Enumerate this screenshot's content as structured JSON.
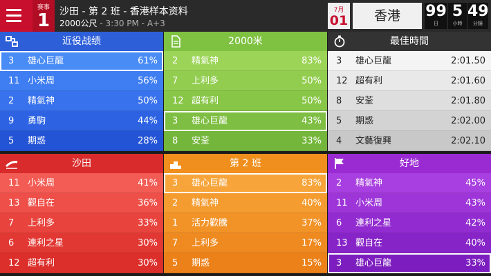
{
  "header": {
    "race_label": "赛事",
    "race_number": "1",
    "venue_line": "沙田 - 第 2 班 - 香港样本资料",
    "distance": "2000公尺",
    "time_handicap": "- 3:30 PM - A+3",
    "date_month": "7月",
    "date_day": "01",
    "place": "香港",
    "countdown": {
      "days": "99",
      "hours": "5",
      "minutes": "49",
      "days_unit": "日",
      "hours_unit": "小時",
      "minutes_unit": "分鐘"
    }
  },
  "colors": {
    "blue_head": "#2d5fd9",
    "green_head": "#7fc242",
    "gray_head": "#333333",
    "red_head": "#d92b2b",
    "orange_head": "#f08f1d",
    "purple_head": "#9a2bd3"
  },
  "panels": [
    {
      "title": "近役战绩",
      "icon": "form-icon",
      "rows": [
        {
          "no": "3",
          "horse": "雄心巨龍",
          "value": "61%",
          "bg": "#4a8cf6",
          "hl": true
        },
        {
          "no": "11",
          "horse": "小米周",
          "value": "56%",
          "bg": "#3e7ef2",
          "hl": false
        },
        {
          "no": "2",
          "horse": "精氣神",
          "value": "50%",
          "bg": "#3872ec",
          "hl": false
        },
        {
          "no": "9",
          "horse": "勇駒",
          "value": "44%",
          "bg": "#2d63e3",
          "hl": false
        },
        {
          "no": "5",
          "horse": "期惑",
          "value": "28%",
          "bg": "#2454d6",
          "hl": false
        }
      ]
    },
    {
      "title": "2000米",
      "icon": "distance-icon",
      "rows": [
        {
          "no": "2",
          "horse": "精氣神",
          "value": "83%",
          "bg": "#9cd457",
          "hl": false
        },
        {
          "no": "7",
          "horse": "上利多",
          "value": "50%",
          "bg": "#92cd50",
          "hl": false
        },
        {
          "no": "12",
          "horse": "超有利",
          "value": "50%",
          "bg": "#88c648",
          "hl": false
        },
        {
          "no": "3",
          "horse": "雄心巨龍",
          "value": "43%",
          "bg": "#7ebe42",
          "hl": true
        },
        {
          "no": "8",
          "horse": "安荃",
          "value": "33%",
          "bg": "#74b63b",
          "hl": false
        }
      ]
    },
    {
      "title": "最佳時間",
      "icon": "stopwatch-icon",
      "rows": [
        {
          "no": "3",
          "horse": "雄心巨龍",
          "value": "2:01.50",
          "bg": "#f4f4f4",
          "hl": false
        },
        {
          "no": "12",
          "horse": "超有利",
          "value": "2:01.60",
          "bg": "#e9e9e9",
          "hl": false
        },
        {
          "no": "8",
          "horse": "安荃",
          "value": "2:01.80",
          "bg": "#dedede",
          "hl": false
        },
        {
          "no": "5",
          "horse": "期惑",
          "value": "2:02.00",
          "bg": "#d3d3d3",
          "hl": false
        },
        {
          "no": "4",
          "horse": "文藝復興",
          "value": "2:02.10",
          "bg": "#c8c8c8",
          "hl": false
        }
      ]
    },
    {
      "title": "沙田",
      "icon": "track-icon",
      "rows": [
        {
          "no": "11",
          "horse": "小米周",
          "value": "41%",
          "bg": "#f25c54",
          "hl": false
        },
        {
          "no": "13",
          "horse": "觀自在",
          "value": "36%",
          "bg": "#ee4f48",
          "hl": false
        },
        {
          "no": "7",
          "horse": "上利多",
          "value": "33%",
          "bg": "#e8433d",
          "hl": false
        },
        {
          "no": "6",
          "horse": "連利之星",
          "value": "30%",
          "bg": "#e23833",
          "hl": false
        },
        {
          "no": "12",
          "horse": "超有利",
          "value": "30%",
          "bg": "#dc2e2a",
          "hl": false
        }
      ]
    },
    {
      "title": "第 2 班",
      "icon": "podium-icon",
      "rows": [
        {
          "no": "3",
          "horse": "雄心巨龍",
          "value": "83%",
          "bg": "#f7a53a",
          "hl": true
        },
        {
          "no": "2",
          "horse": "精氣神",
          "value": "40%",
          "bg": "#f59c30",
          "hl": false
        },
        {
          "no": "1",
          "horse": "活力歡騰",
          "value": "37%",
          "bg": "#f29328",
          "hl": false
        },
        {
          "no": "7",
          "horse": "上利多",
          "value": "17%",
          "bg": "#ef8a20",
          "hl": false
        },
        {
          "no": "5",
          "horse": "期惑",
          "value": "15%",
          "bg": "#ec8119",
          "hl": false
        }
      ]
    },
    {
      "title": "好地",
      "icon": "flag-icon",
      "rows": [
        {
          "no": "2",
          "horse": "精氣神",
          "value": "45%",
          "bg": "#a83fe0",
          "hl": false
        },
        {
          "no": "11",
          "horse": "小米周",
          "value": "43%",
          "bg": "#9d35d8",
          "hl": false
        },
        {
          "no": "6",
          "horse": "連利之星",
          "value": "42%",
          "bg": "#922cd0",
          "hl": false
        },
        {
          "no": "13",
          "horse": "觀自在",
          "value": "40%",
          "bg": "#8724c8",
          "hl": false
        },
        {
          "no": "3",
          "horse": "雄心巨龍",
          "value": "33%",
          "bg": "#7c1dbf",
          "hl": true
        }
      ]
    }
  ]
}
